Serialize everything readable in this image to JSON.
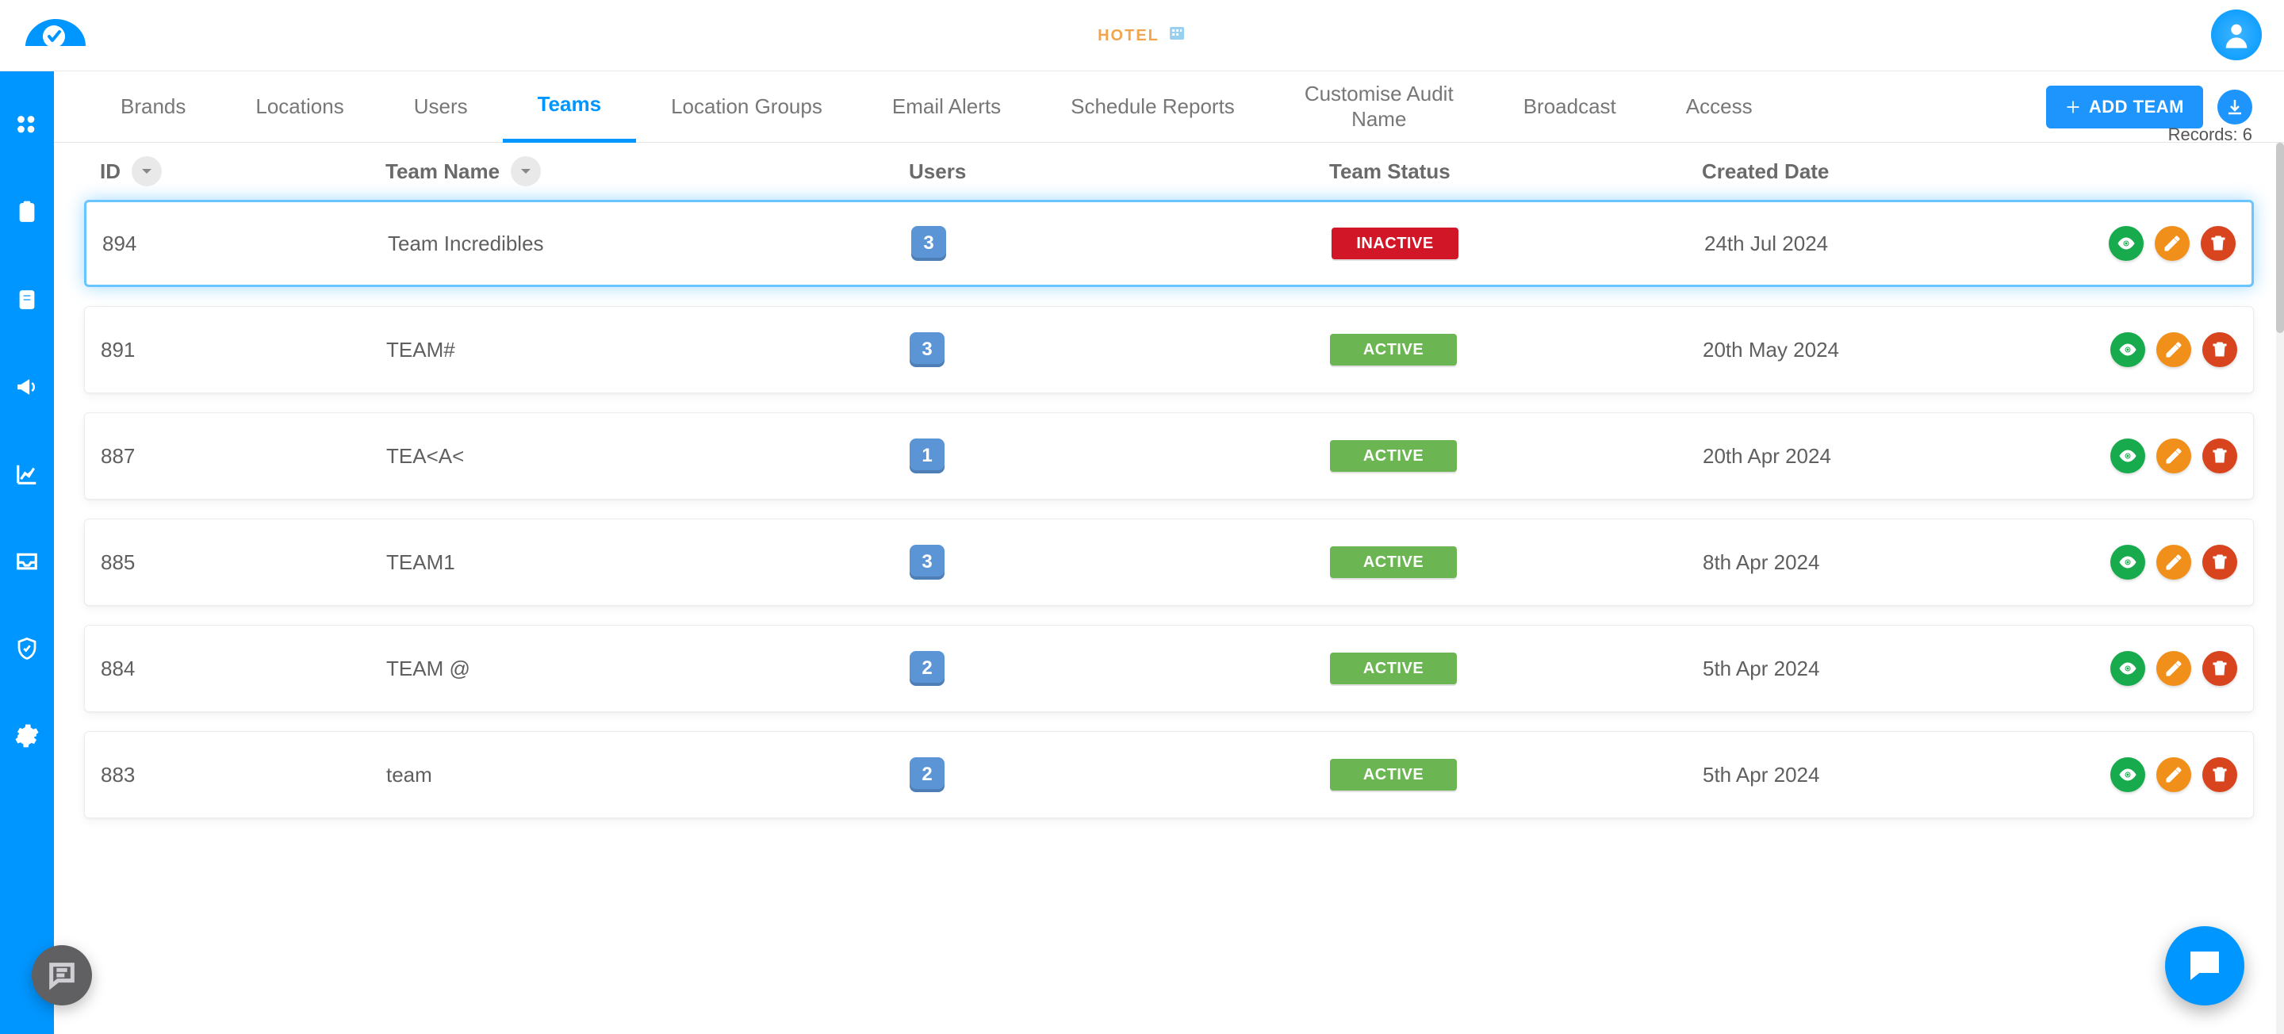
{
  "brand": {
    "label": "HOTEL",
    "icon": "hotel-icon"
  },
  "records": {
    "label": "Records: ",
    "count": 6
  },
  "tabs": [
    {
      "label": "Brands",
      "active": false
    },
    {
      "label": "Locations",
      "active": false
    },
    {
      "label": "Users",
      "active": false
    },
    {
      "label": "Teams",
      "active": true
    },
    {
      "label": "Location Groups",
      "active": false
    },
    {
      "label": "Email Alerts",
      "active": false
    },
    {
      "label": "Schedule Reports",
      "active": false
    },
    {
      "label": "Customise Audit\nName",
      "active": false
    },
    {
      "label": "Broadcast",
      "active": false
    },
    {
      "label": "Access",
      "active": false
    }
  ],
  "add_button": {
    "label": "ADD TEAM"
  },
  "columns": {
    "id": "ID",
    "name": "Team Name",
    "users": "Users",
    "status": "Team Status",
    "date": "Created Date"
  },
  "rows": [
    {
      "id": "894",
      "name": "Team Incredibles",
      "users": "3",
      "status": "INACTIVE",
      "status_kind": "inactive",
      "date": "24th Jul 2024",
      "selected": true
    },
    {
      "id": "891",
      "name": "TEAM#",
      "users": "3",
      "status": "ACTIVE",
      "status_kind": "active",
      "date": "20th May 2024",
      "selected": false
    },
    {
      "id": "887",
      "name": "TEA<A<",
      "users": "1",
      "status": "ACTIVE",
      "status_kind": "active",
      "date": "20th Apr 2024",
      "selected": false
    },
    {
      "id": "885",
      "name": "TEAM1",
      "users": "3",
      "status": "ACTIVE",
      "status_kind": "active",
      "date": "8th Apr 2024",
      "selected": false
    },
    {
      "id": "884",
      "name": "TEAM @",
      "users": "2",
      "status": "ACTIVE",
      "status_kind": "active",
      "date": "5th Apr 2024",
      "selected": false
    },
    {
      "id": "883",
      "name": "team",
      "users": "2",
      "status": "ACTIVE",
      "status_kind": "active",
      "date": "5th Apr 2024",
      "selected": false
    }
  ],
  "sidebar": [
    {
      "label": "dashboard",
      "icon": "apps"
    },
    {
      "label": "audits",
      "icon": "clipboard"
    },
    {
      "label": "document",
      "icon": "doc"
    },
    {
      "label": "announce",
      "icon": "bullhorn"
    },
    {
      "label": "analytics",
      "icon": "analytics"
    },
    {
      "label": "inbox",
      "icon": "inbox"
    },
    {
      "label": "security",
      "icon": "shield"
    },
    {
      "label": "settings",
      "icon": "gear"
    }
  ],
  "icons": {
    "view": "view",
    "edit": "edit",
    "delete": "delete"
  }
}
